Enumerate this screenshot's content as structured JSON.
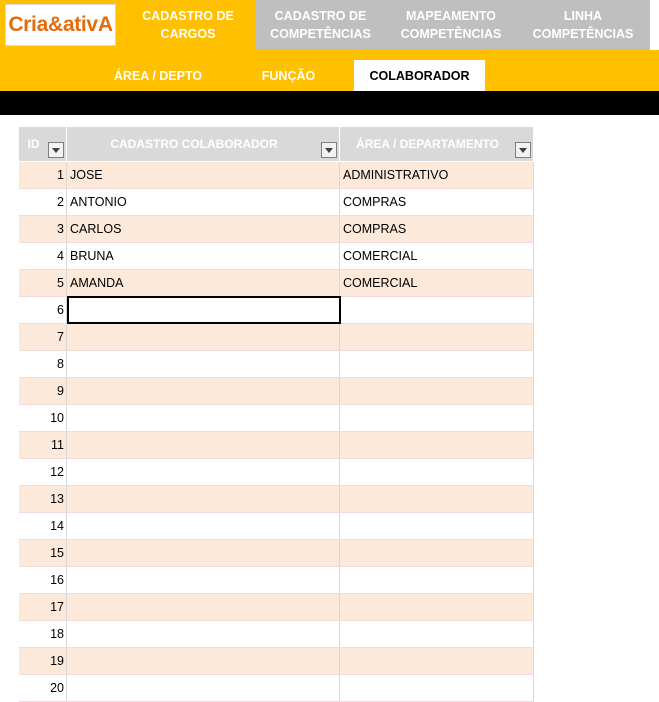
{
  "logo": {
    "text": "Cria&ativA"
  },
  "tabs": [
    {
      "label": "CADASTRO DE\nCARGOS",
      "active": true
    },
    {
      "label": "CADASTRO DE\nCOMPETÊNCIAS",
      "active": false
    },
    {
      "label": "MAPEAMENTO\nCOMPETÊNCIAS",
      "active": false
    },
    {
      "label": "LINHA\nCOMPETÊNCIAS",
      "active": false
    }
  ],
  "subtabs": [
    {
      "label": "ÁREA / DEPTO",
      "active": false
    },
    {
      "label": "FUNÇÃO",
      "active": false
    },
    {
      "label": "COLABORADOR",
      "active": true
    }
  ],
  "table": {
    "headers": {
      "id": "ID",
      "name": "CADASTRO COLABORADOR",
      "area": "ÁREA / DEPARTAMENTO"
    },
    "rows": [
      {
        "id": "1",
        "name": "JOSE",
        "area": "ADMINISTRATIVO"
      },
      {
        "id": "2",
        "name": "ANTONIO",
        "area": "COMPRAS"
      },
      {
        "id": "3",
        "name": "CARLOS",
        "area": "COMPRAS"
      },
      {
        "id": "4",
        "name": "BRUNA",
        "area": "COMERCIAL"
      },
      {
        "id": "5",
        "name": "AMANDA",
        "area": "COMERCIAL"
      },
      {
        "id": "6",
        "name": "",
        "area": ""
      },
      {
        "id": "7",
        "name": "",
        "area": ""
      },
      {
        "id": "8",
        "name": "",
        "area": ""
      },
      {
        "id": "9",
        "name": "",
        "area": ""
      },
      {
        "id": "10",
        "name": "",
        "area": ""
      },
      {
        "id": "11",
        "name": "",
        "area": ""
      },
      {
        "id": "12",
        "name": "",
        "area": ""
      },
      {
        "id": "13",
        "name": "",
        "area": ""
      },
      {
        "id": "14",
        "name": "",
        "area": ""
      },
      {
        "id": "15",
        "name": "",
        "area": ""
      },
      {
        "id": "16",
        "name": "",
        "area": ""
      },
      {
        "id": "17",
        "name": "",
        "area": ""
      },
      {
        "id": "18",
        "name": "",
        "area": ""
      },
      {
        "id": "19",
        "name": "",
        "area": ""
      },
      {
        "id": "20",
        "name": "",
        "area": ""
      }
    ],
    "selected_row": 6
  },
  "colors": {
    "accent": "#ffc000",
    "inactive_tab": "#bfbfbf",
    "band": "#fde9d9",
    "logo_text": "#e46c0a"
  }
}
